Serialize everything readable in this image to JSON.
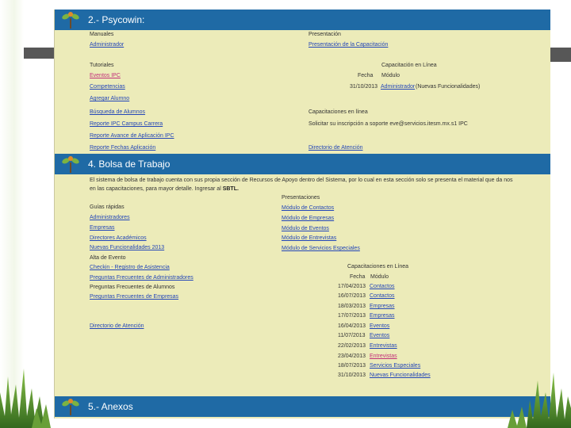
{
  "sections": {
    "psycowin": "2.- Psycowin:",
    "bolsa": "4.  Bolsa de Trabajo",
    "anexos": "5.- Anexos"
  },
  "psycowin": {
    "manuales_header": "Manuales",
    "manuales_link": "Administrador",
    "presentacion_header": "Presentación",
    "presentacion_link": "Presentación de la Capacitación",
    "tutoriales_header": "Tutoriales",
    "tutoriales": [
      "Eventos  IPC",
      "Competencias",
      "Agregar Alumno",
      "Búsqueda de Alumnos",
      "Reporte IPC Campus Carrera",
      "Reporte Avance de Aplicación IPC",
      "Reporte Fechas Aplicación"
    ],
    "cap_header": "Capacitación en Línea",
    "cap_fecha": "Fecha",
    "cap_modulo": "Módulo",
    "cap_date": "31/10/2013",
    "cap_link": "Administrador",
    "cap_note": "(Nuevas Funcionalidades)",
    "cap_header2": "Capacitaciones en línea",
    "solicitar": "Solicitar su inscripción a soporte eve@servicios.itesm.mx.s1 IPC",
    "directorio": "Directorio de Atención"
  },
  "bolsa": {
    "desc_main": "El sistema de bolsa de trabajo cuenta con sus propia sección de Recursos de Apoyo dentro del Sistema, por lo cual en esta sección solo se presenta el material que da nos en las capacitaciones, para mayor detalle. Ingresar al ",
    "desc_bold": "SBTL.",
    "guias_header": "Guías rápidas",
    "guias": [
      "Administradores",
      "Empresas",
      "Directores Académicos",
      "Nuevas Funcionalidades 2013",
      "Alta de Evento",
      "Checkin - Registro de Asistencia",
      "Preguntas Frecuentes de Administradores",
      "Preguntas Frecuentes de Alumnos",
      "Preguntas Frecuentes de Empresas"
    ],
    "presentaciones_header": "Presentaciones",
    "presentaciones": [
      "Módulo de Contactos",
      "Módulo de Empresas",
      "Módulo de Eventos",
      "Módulo de Entrevistas",
      "Módulo de Servicios Especiales"
    ],
    "directorio": "Directorio de Atención",
    "cap_header": "Capacitaciones en Línea",
    "cap_fecha": "Fecha",
    "cap_modulo": "Módulo",
    "cap_rows": [
      {
        "date": "17/04/2013",
        "module": "Contactos"
      },
      {
        "date": "16/07/2013",
        "module": "Contactos"
      },
      {
        "date": "18/03/2013",
        "module": "Empresas"
      },
      {
        "date": "17/07/2013",
        "module": "Empresas"
      },
      {
        "date": "16/04/2013",
        "module": "Eventos"
      },
      {
        "date": "11/07/2013",
        "module": "Eventos"
      },
      {
        "date": "22/02/2013",
        "module": "Entrevistas"
      },
      {
        "date": "23/04/2013",
        "module": "Entrevistas"
      },
      {
        "date": "18/07/2013",
        "module": "Servicios Especiales"
      },
      {
        "date": "31/10/2013",
        "module": "Nuevas Funcionalidades"
      }
    ]
  },
  "colors": {
    "bar": "#1f6aa5",
    "panel": "#ecebb9",
    "link": "#2346b8",
    "visited": "#c2307a"
  }
}
